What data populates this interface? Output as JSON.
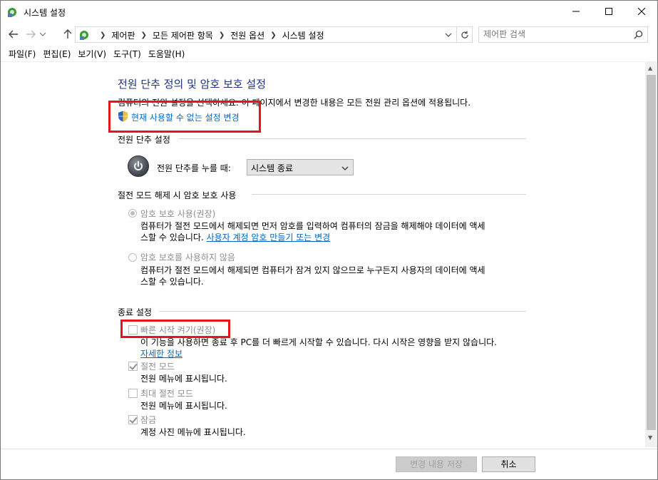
{
  "window": {
    "title": "시스템 설정"
  },
  "address": {
    "crumbs": [
      "제어판",
      "모든 제어판 항목",
      "전원 옵션",
      "시스템 설정"
    ],
    "search_placeholder": "제어판 검색"
  },
  "menu": {
    "items": [
      "파일(F)",
      "편집(E)",
      "보기(V)",
      "도구(T)",
      "도움말(H)"
    ]
  },
  "page": {
    "title": "전원 단추 정의 및 암호 보호 설정",
    "description": "컴퓨터의 전원 설정을 선택하세요. 이 페이지에서 변경한 내용은 모든 전원 관리 옵션에 적용됩니다.",
    "change_settings_link": "현재 사용할 수 없는 설정 변경"
  },
  "power_section": {
    "heading": "전원 단추 설정",
    "label": "전원 단추를 누를 때:",
    "selected": "시스템 종료"
  },
  "password_section": {
    "heading": "절전 모드 해제 시 암호 보호 사용",
    "option1_label": "암호 보호 사용(권장)",
    "option1_desc_line1": "컴퓨터가 절전 모드에서 해제되면 먼저 암호를 입력하여 컴퓨터의 잠금을 해제해야 데이터에 액세",
    "option1_desc_line2": "스할 수 있습니다.",
    "option1_link": "사용자 계정 암호 만들기 또는 변경",
    "option2_label": "암호 보호를 사용하지 않음",
    "option2_desc_line1": "컴퓨터가 절전 모드에서 해제되면 컴퓨터가 잠겨 있지 않으므로 누구든지 사용자의 데이터에 액세",
    "option2_desc_line2": "스할 수 있습니다."
  },
  "shutdown_section": {
    "heading": "종료 설정",
    "fast_startup_label": "빠른 시작 켜기(권장)",
    "fast_startup_desc": "이 기능을 사용하면 종료 후 PC를 더 빠르게 시작할 수 있습니다. 다시 시작은 영향을 받지 않습니다.",
    "more_info_link": "자세한 정보",
    "sleep_label": "절전 모드",
    "sleep_desc": "전원 메뉴에 표시됩니다.",
    "hibernate_label": "최대 절전 모드",
    "hibernate_desc": "전원 메뉴에 표시됩니다.",
    "lock_label": "잠금",
    "lock_desc": "계정 사진 메뉴에 표시됩니다."
  },
  "footer": {
    "save_label": "변경 내용 저장",
    "cancel_label": "취소"
  },
  "colors": {
    "title_blue": "#1e3287",
    "link_blue": "#0066cc",
    "highlight_red": "#e8141c"
  }
}
